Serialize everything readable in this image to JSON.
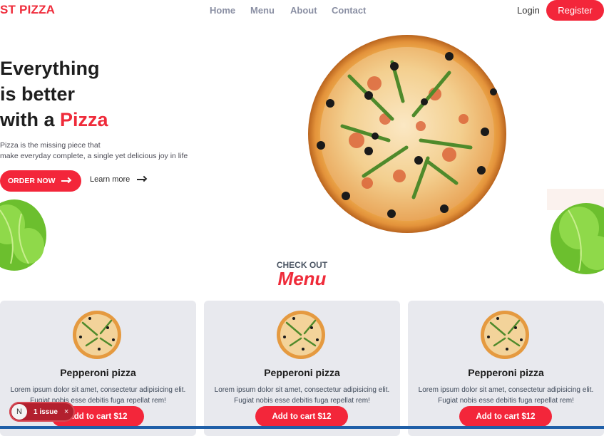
{
  "header": {
    "brand": "ST PIZZA",
    "nav": [
      "Home",
      "Menu",
      "About",
      "Contact"
    ],
    "login": "Login",
    "register": "Register"
  },
  "hero": {
    "line1": "Everything",
    "line2": "is better",
    "line3_prefix": "with a ",
    "line3_accent": "Pizza",
    "sub_line1": "Pizza is the missing piece that",
    "sub_line2": "make everyday complete, a single yet delicious joy in life",
    "order_button": "ORDER NOW",
    "learn_more": "Learn more"
  },
  "menu_section": {
    "eyebrow": "CHECK OUT",
    "title": "Menu",
    "items": [
      {
        "name": "Pepperoni pizza",
        "description": "Lorem ipsum dolor sit amet, consectetur adipisicing elit. Fugiat nobis esse debitis fuga repellat rem!",
        "button": "Add to cart $12"
      },
      {
        "name": "Pepperoni pizza",
        "description": "Lorem ipsum dolor sit amet, consectetur adipisicing elit. Fugiat nobis esse debitis fuga repellat rem!",
        "button": "Add to cart $12"
      },
      {
        "name": "Pepperoni pizza",
        "description": "Lorem ipsum dolor sit amet, consectetur adipisicing elit. Fugiat nobis esse debitis fuga repellat rem!",
        "button": "Add to cart $12"
      }
    ]
  },
  "dev_overlay": {
    "logo_letter": "N",
    "issues": "1 issue",
    "close": "×"
  },
  "colors": {
    "accent": "#ef2b3a",
    "button": "#f3263a",
    "card_bg": "#e8e9ee",
    "nav_text": "#8a8fa3"
  },
  "icons": {
    "order_arrow": "arrow-right-icon",
    "learn_arrow": "arrow-right-icon",
    "close": "close-icon"
  }
}
